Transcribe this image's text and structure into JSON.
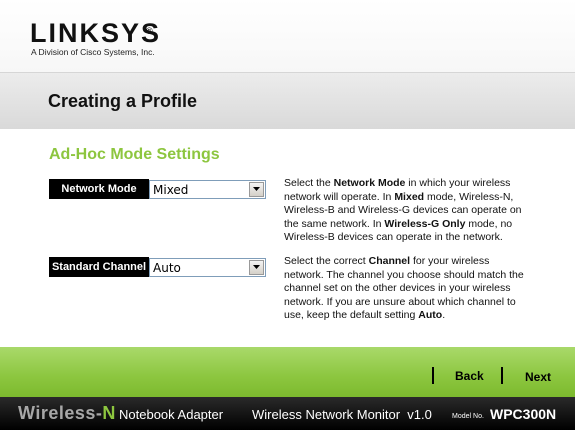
{
  "header": {
    "logo_text": "LINKSYS",
    "logo_mark": "®",
    "tagline": "A Division of Cisco Systems, Inc."
  },
  "page": {
    "title": "Creating a Profile",
    "section_title": "Ad-Hoc Mode Settings"
  },
  "fields": [
    {
      "label": "Network Mode",
      "value": "Mixed",
      "help": [
        {
          "t": "Select the ",
          "b": false
        },
        {
          "t": "Network Mode",
          "b": true
        },
        {
          "t": " in which your wireless network will operate. In ",
          "b": false
        },
        {
          "t": "Mixed",
          "b": true
        },
        {
          "t": " mode, Wireless-N, Wireless-B and Wireless-G devices can operate on the same network. In ",
          "b": false
        },
        {
          "t": "Wireless-G Only",
          "b": true
        },
        {
          "t": " mode, no Wireless-B devices can operate in the network.",
          "b": false
        }
      ]
    },
    {
      "label": "Standard Channel",
      "value": "Auto",
      "help": [
        {
          "t": "Select the correct ",
          "b": false
        },
        {
          "t": "Channel",
          "b": true
        },
        {
          "t": " for your wireless network. The channel you choose should match the channel set on the other devices in your wireless network. If you are unsure about which channel to use, keep the default setting ",
          "b": false
        },
        {
          "t": "Auto",
          "b": true
        },
        {
          "t": ".",
          "b": false
        }
      ]
    }
  ],
  "nav": {
    "back_label": "Back",
    "next_label": "Next"
  },
  "footer": {
    "brand_prefix": "Wireless-",
    "brand_suffix": "N",
    "product": "Notebook Adapter",
    "app_name": "Wireless Network Monitor  v1.0",
    "model_label": "Model No.",
    "model": "WPC300N"
  },
  "colors": {
    "accent_green": "#8dc63f",
    "bar_black": "#000000"
  }
}
